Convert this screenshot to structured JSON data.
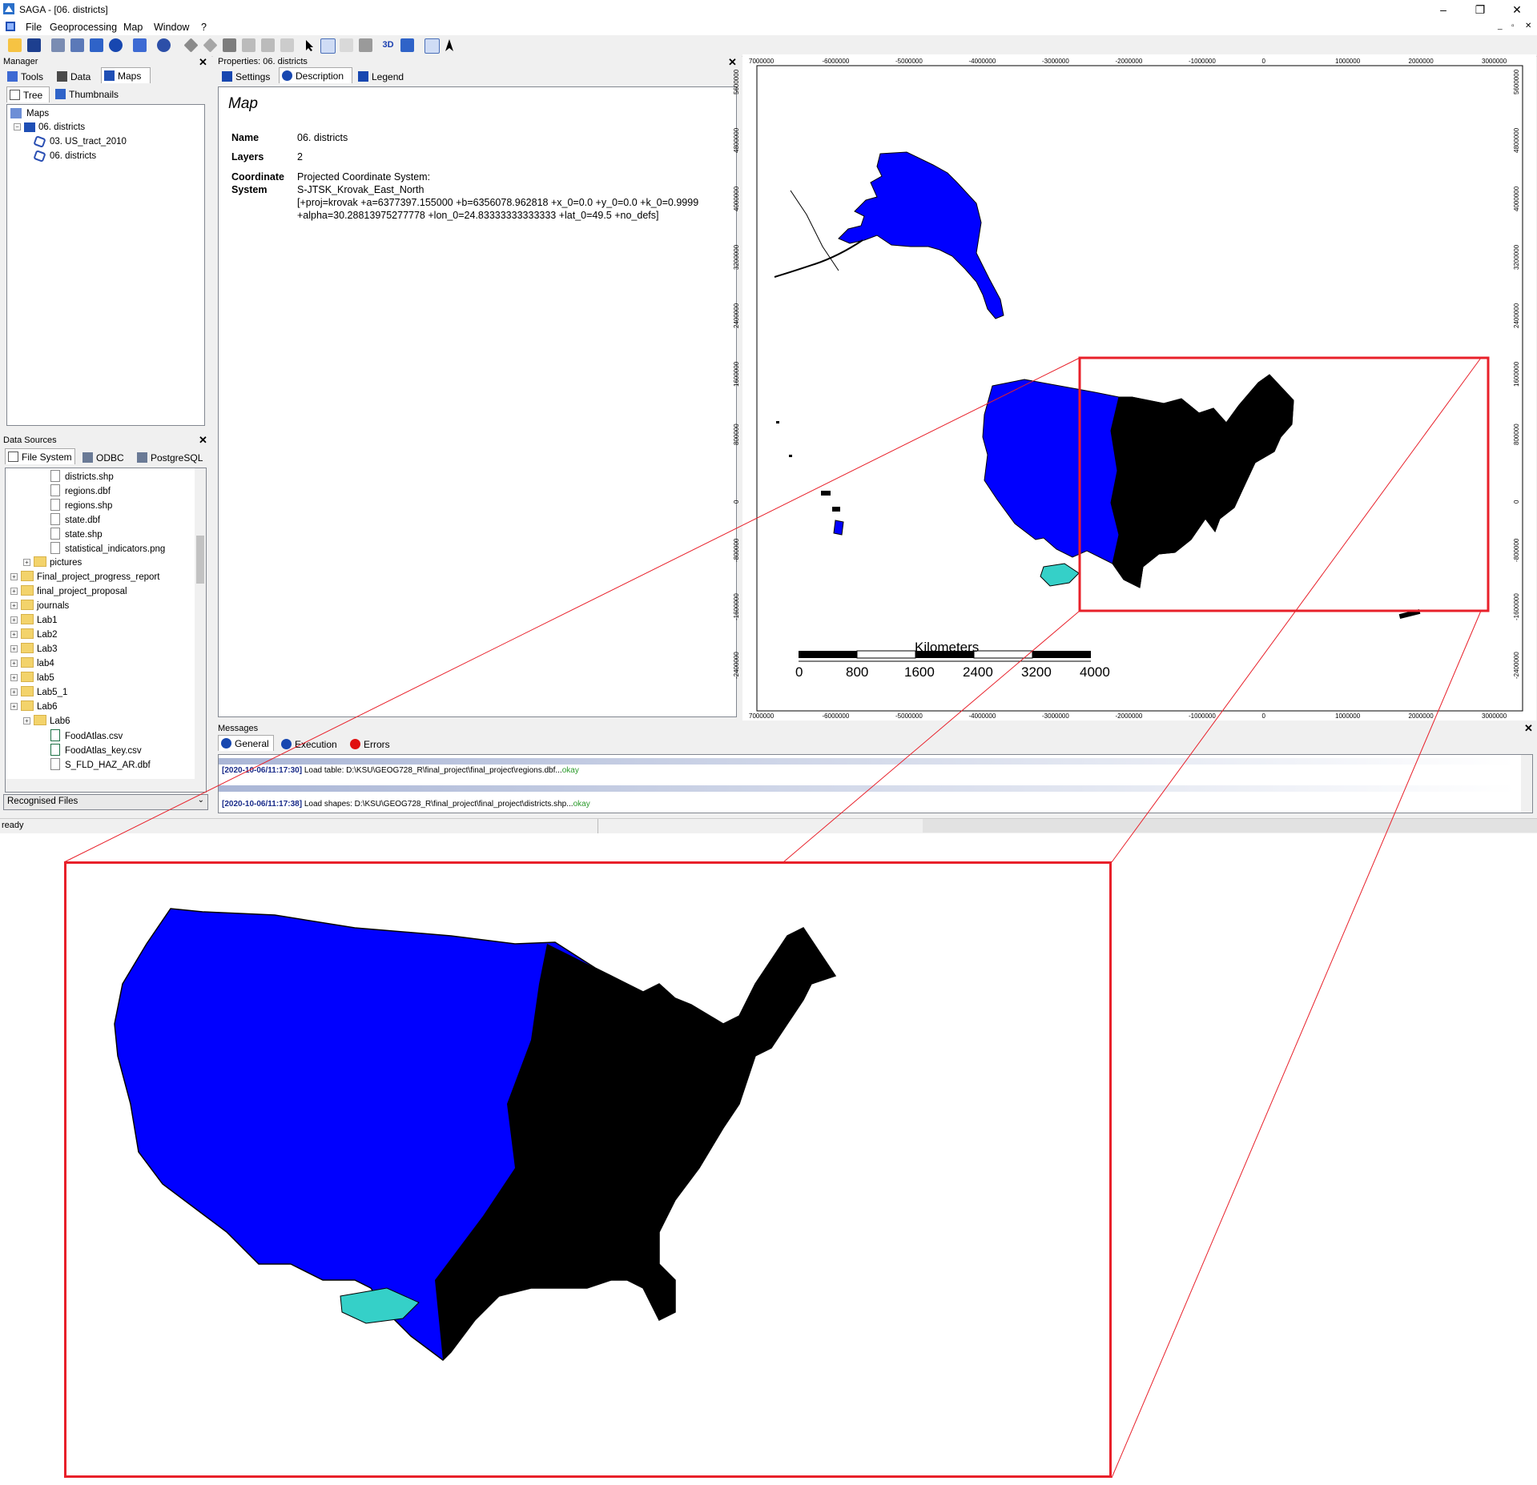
{
  "window": {
    "title": "SAGA - [06. districts]",
    "icon": "saga-app-icon",
    "controls": [
      "–",
      "❐",
      "✕"
    ]
  },
  "menu": {
    "items": [
      "File",
      "Geoprocessing",
      "Map",
      "Window",
      "?"
    ]
  },
  "manager": {
    "title": "Manager",
    "tabs": [
      "Tools",
      "Data",
      "Maps"
    ],
    "subtabs": [
      "Tree",
      "Thumbnails"
    ],
    "tree": {
      "root": "Maps",
      "map": "06. districts",
      "layers": [
        "03. US_tract_2010",
        "06. districts"
      ]
    }
  },
  "data_sources": {
    "title": "Data Sources",
    "tabs": [
      "File System",
      "ODBC",
      "PostgreSQL"
    ],
    "files": [
      {
        "label": "districts.shp",
        "kind": "file",
        "level": 3
      },
      {
        "label": "regions.dbf",
        "kind": "file",
        "level": 3
      },
      {
        "label": "regions.shp",
        "kind": "file",
        "level": 3
      },
      {
        "label": "state.dbf",
        "kind": "file",
        "level": 3
      },
      {
        "label": "state.shp",
        "kind": "file",
        "level": 3
      },
      {
        "label": "statistical_indicators.png",
        "kind": "file",
        "level": 3
      },
      {
        "label": "pictures",
        "kind": "folder",
        "level": 2
      },
      {
        "label": "Final_project_progress_report",
        "kind": "folder",
        "level": 1
      },
      {
        "label": "final_project_proposal",
        "kind": "folder",
        "level": 1
      },
      {
        "label": "journals",
        "kind": "folder",
        "level": 1
      },
      {
        "label": "Lab1",
        "kind": "folder",
        "level": 1
      },
      {
        "label": "Lab2",
        "kind": "folder",
        "level": 1
      },
      {
        "label": "Lab3",
        "kind": "folder",
        "level": 1
      },
      {
        "label": "lab4",
        "kind": "folder",
        "level": 1
      },
      {
        "label": "lab5",
        "kind": "folder",
        "level": 1
      },
      {
        "label": "Lab5_1",
        "kind": "folder",
        "level": 1
      },
      {
        "label": "Lab6",
        "kind": "folder",
        "level": 1
      },
      {
        "label": "Lab6",
        "kind": "folder",
        "level": 2
      },
      {
        "label": "FoodAtlas.csv",
        "kind": "xfile",
        "level": 3
      },
      {
        "label": "FoodAtlas_key.csv",
        "kind": "xfile",
        "level": 3
      },
      {
        "label": "S_FLD_HAZ_AR.dbf",
        "kind": "file",
        "level": 3
      }
    ],
    "filter": "Recognised Files"
  },
  "properties": {
    "title": "Properties: 06. districts",
    "tabs": [
      "Settings",
      "Description",
      "Legend"
    ],
    "heading": "Map",
    "rows": [
      {
        "key": "Name",
        "value": [
          "06. districts"
        ]
      },
      {
        "key": "Layers",
        "value": [
          "2"
        ]
      },
      {
        "key": "Coordinate System",
        "value": [
          "Projected Coordinate System:",
          "S-JTSK_Krovak_East_North",
          "[+proj=krovak +a=6377397.155000 +b=6356078.962818 +x_0=0.0 +y_0=0.0 +k_0=0.9999",
          "+alpha=30.28813975277778 +lon_0=24.83333333333333 +lat_0=49.5 +no_defs]"
        ]
      }
    ]
  },
  "map": {
    "x_ticks": [
      "7000000",
      "-6000000",
      "-5000000",
      "-4000000",
      "-3000000",
      "-2000000",
      "-1000000",
      "0",
      "1000000",
      "2000000",
      "3000000"
    ],
    "y_ticks": [
      "5600000",
      "4800000",
      "4000000",
      "3200000",
      "2400000",
      "1600000",
      "800000",
      "0",
      "-800000",
      "-1600000",
      "-2400000"
    ],
    "scalebar": {
      "title": "Kilometers",
      "labels": [
        "0",
        "800",
        "1600",
        "2400",
        "3200",
        "4000"
      ]
    },
    "colors": {
      "fill": "#0000ff",
      "outline": "#000000",
      "czech": "#35d0c8",
      "highlight": "#e8202a"
    }
  },
  "messages": {
    "title": "Messages",
    "tabs": [
      "General",
      "Execution",
      "Errors"
    ],
    "lines": [
      {
        "time": "[2020-10-06/11:17:30]",
        "text": " Load table: D:\\KSU\\GEOG728_R\\final_project\\final_project\\regions.dbf...",
        "status": "okay"
      },
      {
        "time": "[2020-10-06/11:17:38]",
        "text": " Load shapes: D:\\KSU\\GEOG728_R\\final_project\\final_project\\districts.shp...",
        "status": "okay"
      }
    ]
  },
  "status": {
    "text": "ready"
  }
}
